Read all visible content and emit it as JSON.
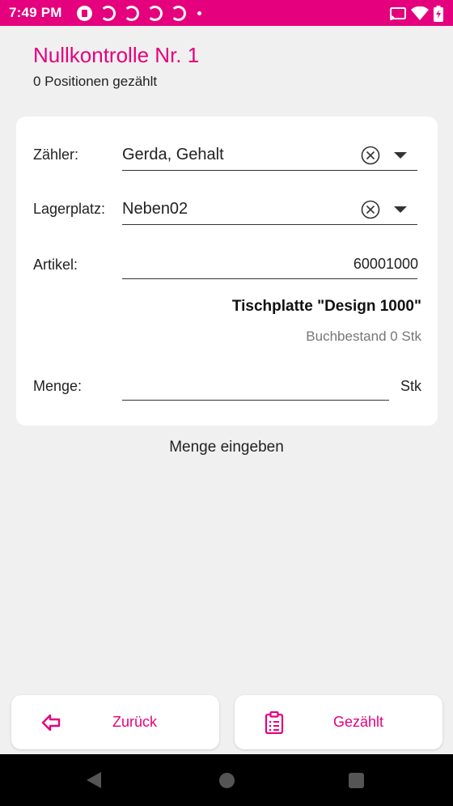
{
  "status": {
    "time": "7:49 PM"
  },
  "header": {
    "title": "Nullkontrolle Nr. 1",
    "subtitle": "0 Positionen gezählt"
  },
  "form": {
    "counter_label": "Zähler:",
    "counter_value": "Gerda, Gehalt",
    "location_label": "Lagerplatz:",
    "location_value": "Neben02",
    "article_label": "Artikel:",
    "article_value": "60001000",
    "product_name": "Tischplatte \"Design 1000\"",
    "stock_text": "Buchbestand 0 Stk",
    "quantity_label": "Menge:",
    "quantity_value": "",
    "quantity_unit": "Stk"
  },
  "hint": "Menge eingeben",
  "buttons": {
    "back_label": "Zurück",
    "counted_label": "Gezählt"
  },
  "colors": {
    "accent": "#e5007d",
    "background": "#f0f0f0"
  }
}
